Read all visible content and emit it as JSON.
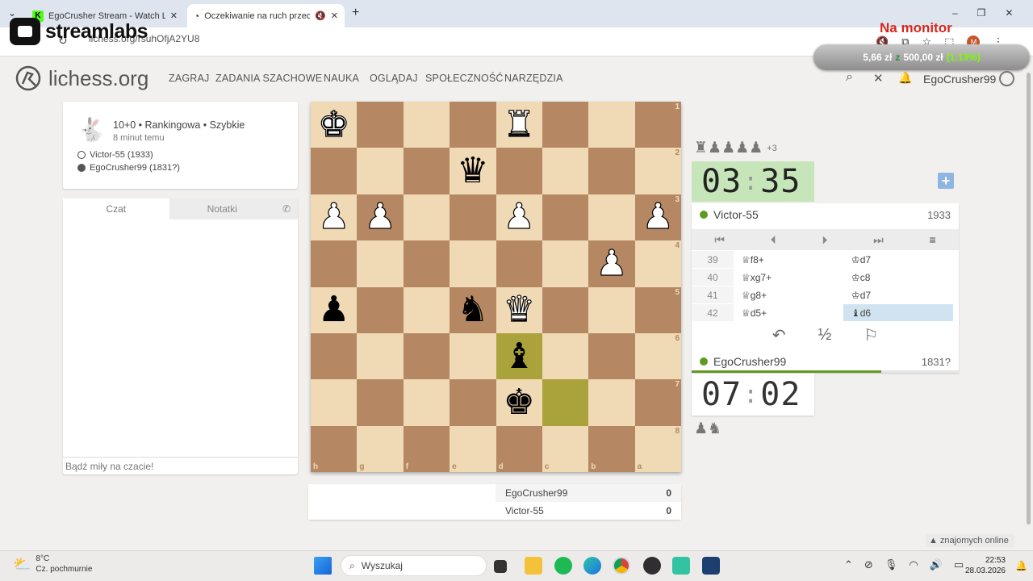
{
  "browser": {
    "tabs": [
      {
        "title": "EgoCrusher Stream - Watch Live"
      },
      {
        "title": "Oczekiwanie na ruch przeci"
      }
    ],
    "url": "lichess.org/rsuhOfjA2YU8"
  },
  "overlay": {
    "brand": "streamlabs",
    "monitor_label": "Na monitor",
    "donation_amount": "5,66 zł",
    "donation_sep": "z",
    "donation_goal": "500,00 zł",
    "donation_pct": "(1.13%)"
  },
  "site": {
    "logo": "lichess.org",
    "nav": [
      "ZAGRAJ",
      "ZADANIA SZACHOWE",
      "NAUKA",
      "OGLĄDAJ",
      "SPOŁECZNOŚĆ",
      "NARZĘDZIA"
    ],
    "username": "EgoCrusher99"
  },
  "game_info": {
    "setup": "10+0 • Rankingowa • Szybkie",
    "time_ago": "8 minut temu",
    "white_player": "Victor-55 (1933)",
    "black_player": "EgoCrusher99 (1831?)"
  },
  "chat": {
    "tab_chat": "Czat",
    "tab_notes": "Notatki",
    "placeholder": "Bądź miły na czacie!"
  },
  "board": {
    "ranks": [
      "1",
      "2",
      "3",
      "4",
      "5",
      "6",
      "7",
      "8"
    ],
    "files": [
      "h",
      "g",
      "f",
      "e",
      "d",
      "c",
      "b",
      "a"
    ],
    "orientation": "black",
    "pieces": [
      {
        "sq": "h1",
        "piece": "♚",
        "color": "white"
      },
      {
        "sq": "d1",
        "piece": "♜",
        "color": "white"
      },
      {
        "sq": "e2",
        "piece": "♛",
        "color": "black"
      },
      {
        "sq": "h3",
        "piece": "♟",
        "color": "white"
      },
      {
        "sq": "g3",
        "piece": "♟",
        "color": "white"
      },
      {
        "sq": "d3",
        "piece": "♟",
        "color": "white"
      },
      {
        "sq": "a3",
        "piece": "♟",
        "color": "white"
      },
      {
        "sq": "b4",
        "piece": "♟",
        "color": "white"
      },
      {
        "sq": "h5",
        "piece": "♟",
        "color": "black"
      },
      {
        "sq": "e5",
        "piece": "♞",
        "color": "black"
      },
      {
        "sq": "d5",
        "piece": "♛",
        "color": "white"
      },
      {
        "sq": "d6",
        "piece": "♝",
        "color": "black"
      },
      {
        "sq": "d7",
        "piece": "♚",
        "color": "black"
      }
    ],
    "highlighted": [
      "d6",
      "c7"
    ]
  },
  "crosstable": [
    {
      "name": "EgoCrusher99",
      "score": "0"
    },
    {
      "name": "Victor-55",
      "score": "0"
    }
  ],
  "opponent": {
    "material": "♜♟♟♟♟",
    "material_diff": "+3",
    "clock_min": "03",
    "clock_sec": "35",
    "name": "Victor-55",
    "rating": "1933"
  },
  "me": {
    "name": "EgoCrusher99",
    "rating": "1831?",
    "clock_min": "07",
    "clock_sec": "02",
    "material": "♟♞",
    "clock_bar_fraction": 0.71
  },
  "moves": [
    {
      "n": "39",
      "w": "♕f8+",
      "b": "♔d7"
    },
    {
      "n": "40",
      "w": "♕xg7+",
      "b": "♔c8"
    },
    {
      "n": "41",
      "w": "♕g8+",
      "b": "♔d7"
    },
    {
      "n": "42",
      "w": "♕d5+",
      "b": "♝d6"
    }
  ],
  "controls": [
    "⏮",
    "⏴",
    "⏵",
    "⏭",
    "≡"
  ],
  "actions": [
    "↶",
    "½",
    "⚐"
  ],
  "online_friends": "znajomych online",
  "taskbar": {
    "weather_temp": "8°C",
    "weather_desc": "Cz. pochmurnie",
    "search": "Wyszukaj",
    "time": "22:53",
    "date": "28.03.2026"
  }
}
